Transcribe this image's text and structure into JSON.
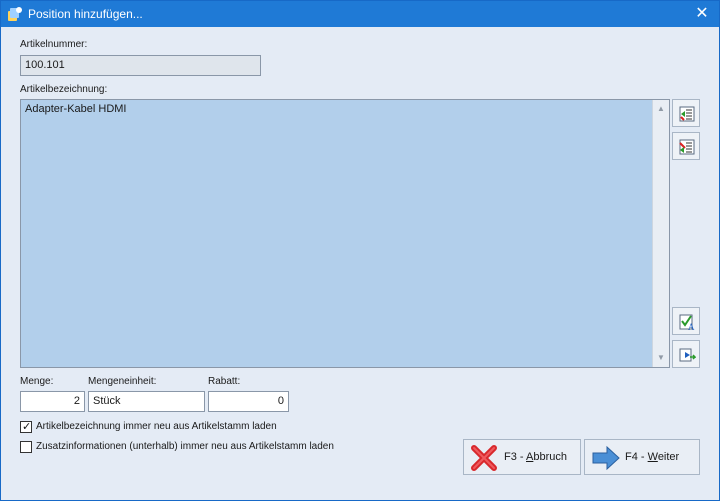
{
  "window": {
    "title": "Position hinzufügen..."
  },
  "form": {
    "artikelnummer_label": "Artikelnummer:",
    "artikelnummer_value": "100.101",
    "artikelbezeichnung_label": "Artikelbezeichnung:",
    "artikelbezeichnung_value": "Adapter-Kabel HDMI",
    "menge_label": "Menge:",
    "menge_value": "2",
    "mengeneinheit_label": "Mengeneinheit:",
    "mengeneinheit_value": "Stück",
    "rabatt_label": "Rabatt:",
    "rabatt_value": "0"
  },
  "checkboxes": [
    {
      "label": "Artikelbezeichnung immer neu aus Artikelstamm laden",
      "checked": true
    },
    {
      "label": "Zusatzinformationen (unterhalb) immer neu aus Artikelstamm laden",
      "checked": false
    }
  ],
  "buttons": {
    "cancel_prefix": "F3 - ",
    "cancel_accel": "A",
    "cancel_rest": "bbruch",
    "next_prefix": "F4 - ",
    "next_accel": "W",
    "next_rest": "eiter"
  },
  "icons": {
    "app": "app-icon",
    "side_1": "list-add-icon",
    "side_2": "list-remove-icon",
    "side_3": "spellcheck-icon",
    "side_4": "insert-arrow-icon",
    "cancel": "red-x-icon",
    "next": "blue-arrow-right-icon"
  },
  "colors": {
    "titlebar": "#1f7ad6",
    "memo_bg": "#b2cfeb",
    "window_bg": "#e4ebf5"
  }
}
